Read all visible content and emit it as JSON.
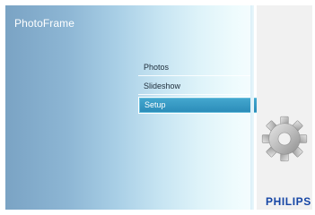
{
  "app": {
    "title": "PhotoFrame"
  },
  "menu": {
    "items": [
      {
        "label": "Photos",
        "selected": false
      },
      {
        "label": "Slideshow",
        "selected": false
      },
      {
        "label": "Setup",
        "selected": true
      }
    ]
  },
  "side_panel": {
    "icon": "gear-icon"
  },
  "brand": {
    "logo_text": "PHILIPS"
  },
  "colors": {
    "selected_item": "#2f93c0",
    "brand": "#1646a5",
    "title_text": "#ffffff"
  }
}
